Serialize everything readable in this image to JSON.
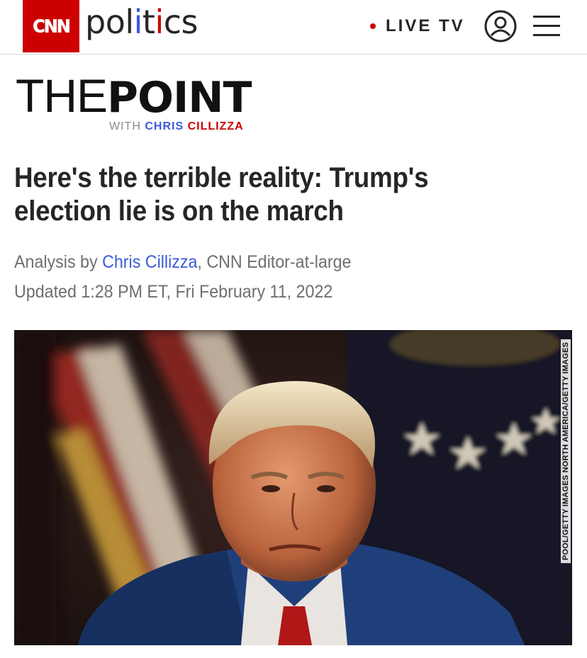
{
  "header": {
    "logo_text": "CNN",
    "section_parts": [
      "pol",
      "i",
      "t",
      "i",
      "cs"
    ],
    "live_label": "LIVE TV",
    "colors": {
      "brand_red": "#cc0000",
      "accent_blue": "#3b5bdb"
    },
    "icons": [
      "live-dot-icon",
      "user-account-icon",
      "hamburger-menu-icon"
    ]
  },
  "branding": {
    "title_thin": "THE",
    "title_bold": "POINT",
    "byline_with": "WITH",
    "byline_first": "CHRIS",
    "byline_last": "CILLIZZA"
  },
  "article": {
    "headline": "Here's the terrible reality: Trump's election lie is on the march",
    "analysis_prefix": "Analysis by",
    "author": "Chris Cillizza",
    "author_role": ", CNN Editor-at-large",
    "updated": "Updated 1:28 PM ET, Fri February 11, 2022",
    "image_credit": "POOL/GETTY IMAGES NORTH AMERICA/GETTY IMAGES"
  }
}
